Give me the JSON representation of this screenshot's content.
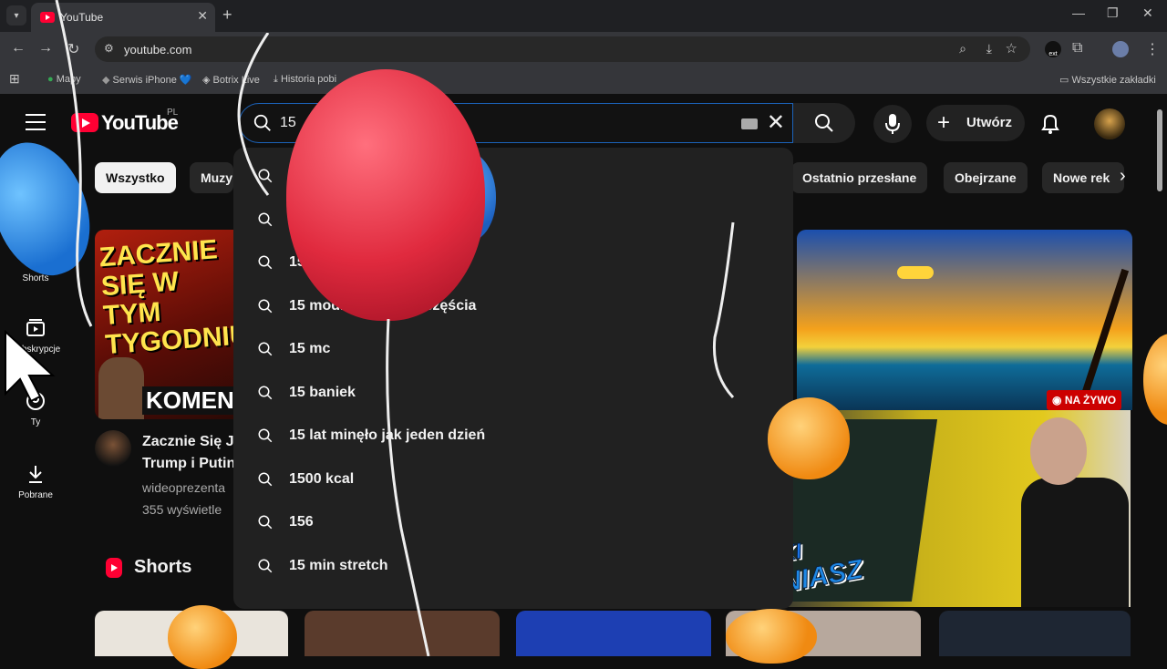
{
  "browser": {
    "tab_title": "YouTube",
    "url": "youtube.com",
    "bookmarks": [
      "Mapy",
      "Serwis iPhone 💙",
      "Botrix Live",
      "Historia pobi",
      "Wszystkie zakładki"
    ],
    "ext_badge": "ext"
  },
  "header": {
    "logo_text": "YouTube",
    "country_code": "PL",
    "search_value": "15",
    "create_label": "Utwórz"
  },
  "guide": [
    {
      "label": "Shorts",
      "icon": "shorts-icon"
    },
    {
      "label": "Subskrypcje",
      "icon": "subscriptions-icon"
    },
    {
      "label": "Ty",
      "icon": "you-icon"
    },
    {
      "label": "Pobrane",
      "icon": "download-icon"
    }
  ],
  "chips": [
    "Wszystko",
    "Muzy",
    "Ostatnio przesłane",
    "Obejrzane",
    "Nowe rek"
  ],
  "suggestions": [
    "1",
    "15 n",
    "15 modlitw ... ica szczęścia",
    "15 mc",
    "15 baniek",
    "15 lat minęło jak jeden dzień",
    "1500 kcal",
    "156",
    "15 min stretch"
  ],
  "video_card": {
    "thumbnail_text": "ZACZNIE SIĘ W TYM TYGODNIU",
    "thumbnail_banner": "KOMENTA",
    "title_line1": "Zacznie Się J",
    "title_line2": "Trump i Putin",
    "channel": "wideoprezenta",
    "views": "355 wyświetle"
  },
  "live_badge": "NA ŻYWO",
  "shorts_title": "Shorts",
  "overlay_brand": {
    "line1": "POETYCKI",
    "line2": "FAFLENIASZ"
  },
  "colors": {
    "accent": "#ff0033",
    "search_border": "#1c62b9",
    "live": "#cc0000"
  }
}
